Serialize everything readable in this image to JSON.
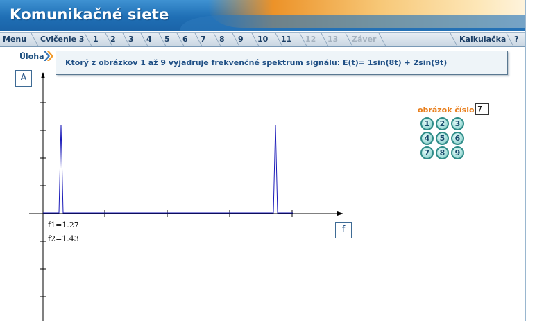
{
  "app": {
    "title": "Komunikačné siete"
  },
  "nav": {
    "tabs": [
      {
        "label": "Menu",
        "enabled": true
      },
      {
        "label": "Cvičenie 3",
        "enabled": true
      },
      {
        "label": "1",
        "enabled": true
      },
      {
        "label": "2",
        "enabled": true
      },
      {
        "label": "3",
        "enabled": true
      },
      {
        "label": "4",
        "enabled": true
      },
      {
        "label": "5",
        "enabled": true
      },
      {
        "label": "6",
        "enabled": true
      },
      {
        "label": "7",
        "enabled": true
      },
      {
        "label": "8",
        "enabled": true
      },
      {
        "label": "9",
        "enabled": true
      },
      {
        "label": "10",
        "enabled": true
      },
      {
        "label": "11",
        "enabled": true
      },
      {
        "label": "12",
        "enabled": false
      },
      {
        "label": "13",
        "enabled": false
      },
      {
        "label": "Záver",
        "enabled": false
      }
    ],
    "right_tabs": [
      {
        "label": "Kalkulačka",
        "enabled": true
      },
      {
        "label": "?",
        "enabled": true
      }
    ]
  },
  "task": {
    "label": "Úloha",
    "question": "Ktorý z obrázkov 1 až 9 vyjadruje frekvenčné spektrum signálu: E(t)= 1sin(8t) + 2sin(9t)"
  },
  "graph": {
    "y_axis_label": "A",
    "x_axis_label": "f",
    "f1_text": "f1=1.27",
    "f2_text": "f2=1.43"
  },
  "picker": {
    "label": "obrázok číslo:",
    "value": "7",
    "buttons": [
      "1",
      "2",
      "3",
      "4",
      "5",
      "6",
      "7",
      "8",
      "9"
    ]
  },
  "colors": {
    "title_bar": "#1f6fb5",
    "accent_orange": "#ec9228",
    "spectrum_line": "#1a1ab8",
    "button_teal": "#2f8c88"
  }
}
